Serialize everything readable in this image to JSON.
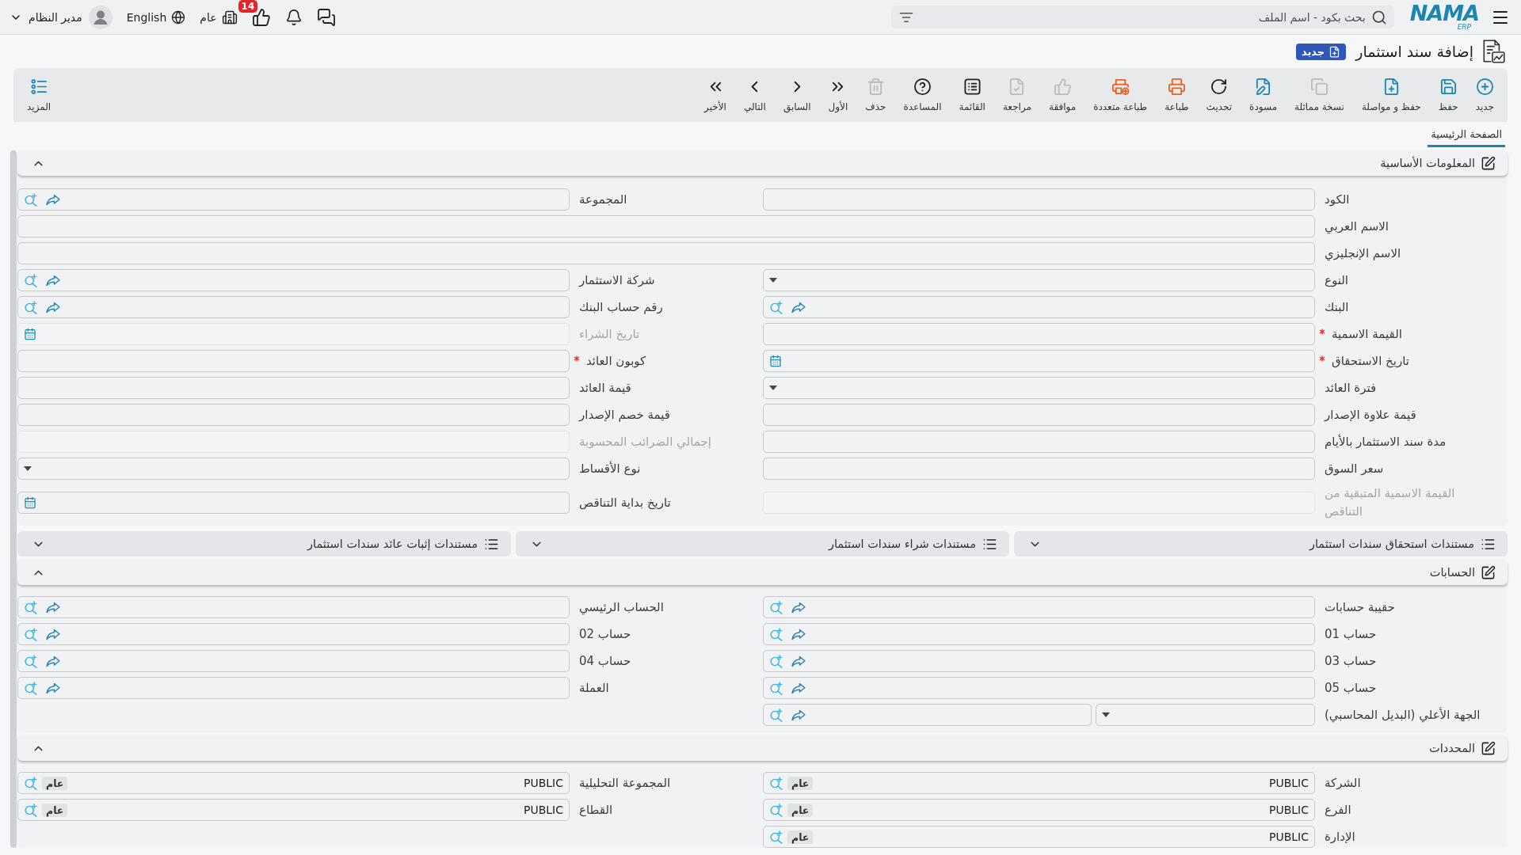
{
  "header": {
    "logo": {
      "name": "NAMA",
      "tagline": "ERP"
    },
    "search": {
      "placeholder": "بحث بكود - اسم الملف"
    },
    "approvals_badge": "14",
    "branch": "عام",
    "language": "English",
    "user": "مدير النظام"
  },
  "page": {
    "title": "إضافة سند استثمار",
    "status": "جديد"
  },
  "toolbar": {
    "buttons": [
      {
        "label": "جديد",
        "kind": "new",
        "disabled": false
      },
      {
        "label": "حفظ",
        "kind": "save",
        "disabled": false
      },
      {
        "label": "حفظ و مواصلة",
        "kind": "save-continue",
        "disabled": false
      },
      {
        "label": "نسخة مماثلة",
        "kind": "duplicate",
        "disabled": true
      },
      {
        "label": "مسودة",
        "kind": "draft",
        "disabled": false
      },
      {
        "label": "تحديث",
        "kind": "refresh",
        "disabled": false
      },
      {
        "label": "طباعة",
        "kind": "print",
        "disabled": false
      },
      {
        "label": "طباعة متعددة",
        "kind": "multi-print",
        "disabled": false
      },
      {
        "label": "موافقة",
        "kind": "approve",
        "disabled": true
      },
      {
        "label": "مراجعة",
        "kind": "review",
        "disabled": true
      },
      {
        "label": "القائمة",
        "kind": "list",
        "disabled": false
      },
      {
        "label": "المساعدة",
        "kind": "help",
        "disabled": false
      },
      {
        "label": "حذف",
        "kind": "delete",
        "disabled": true
      },
      {
        "label": "الأول",
        "kind": "first",
        "disabled": false
      },
      {
        "label": "السابق",
        "kind": "previous",
        "disabled": false
      },
      {
        "label": "التالي",
        "kind": "next",
        "disabled": false
      },
      {
        "label": "الأخير",
        "kind": "last",
        "disabled": false
      }
    ],
    "more": "المزيد"
  },
  "tabs": [
    {
      "label": "الصفحة الرئيسية",
      "selected": true
    }
  ],
  "basic_info": {
    "title": "المعلومات الأساسية",
    "expanded": true,
    "fields": [
      {
        "label": "الكود",
        "kind": "text",
        "required": false,
        "disabled": false
      },
      {
        "label": "المجموعة",
        "kind": "lookup",
        "required": false,
        "disabled": false
      },
      {
        "label": "الاسم العربي",
        "kind": "text",
        "wide": true,
        "required": false,
        "disabled": false
      },
      {
        "label": "الاسم الإنجليزي",
        "kind": "text",
        "wide": true,
        "required": false,
        "disabled": false
      },
      {
        "label": "النوع",
        "kind": "select",
        "required": false,
        "disabled": false
      },
      {
        "label": "شركة الاستثمار",
        "kind": "lookup",
        "required": false,
        "disabled": false
      },
      {
        "label": "البنك",
        "kind": "lookup",
        "required": false,
        "disabled": false
      },
      {
        "label": "رقم حساب البنك",
        "kind": "lookup",
        "required": false,
        "disabled": false
      },
      {
        "label": "القيمة الاسمية",
        "kind": "text",
        "required": true,
        "disabled": false
      },
      {
        "label": "تاريخ الشراء",
        "kind": "date",
        "required": false,
        "disabled": true
      },
      {
        "label": "تاريخ الاستحقاق",
        "kind": "date",
        "required": true,
        "disabled": false
      },
      {
        "label": "كوبون العائد",
        "kind": "text",
        "required": true,
        "disabled": false
      },
      {
        "label": "فترة العائد",
        "kind": "select",
        "required": false,
        "disabled": false
      },
      {
        "label": "قيمة العائد",
        "kind": "text",
        "required": false,
        "disabled": false
      },
      {
        "label": "قيمة علاوة الإصدار",
        "kind": "text",
        "required": false,
        "disabled": false
      },
      {
        "label": "قيمة خصم الإصدار",
        "kind": "text",
        "required": false,
        "disabled": false
      },
      {
        "label": "مدة سند الاستثمار بالأيام",
        "kind": "text",
        "required": false,
        "disabled": false
      },
      {
        "label": "إجمالي الضرائب المحسوبة",
        "kind": "text",
        "required": false,
        "disabled": true
      },
      {
        "label": "سعر السوق",
        "kind": "text",
        "required": false,
        "disabled": false
      },
      {
        "label": "نوع الأقساط",
        "kind": "select",
        "required": false,
        "disabled": false
      },
      {
        "label": "القيمة الاسمية المتبقية من التناقص",
        "kind": "text",
        "required": false,
        "disabled": true
      },
      {
        "label": "تاريخ بداية التناقص",
        "kind": "date",
        "required": false,
        "disabled": false
      }
    ]
  },
  "document_panels": [
    {
      "title": "مستندات استحقاق سندات استثمار",
      "expanded": false
    },
    {
      "title": "مستندات شراء سندات استثمار",
      "expanded": false
    },
    {
      "title": "مستندات إثبات عائد سندات استثمار",
      "expanded": false
    }
  ],
  "accounts": {
    "title": "الحسابات",
    "expanded": true,
    "fields": [
      {
        "label": "حقيبة حسابات",
        "kind": "lookup"
      },
      {
        "label": "الحساب الرئيسي",
        "kind": "lookup"
      },
      {
        "label": "حساب 01",
        "kind": "lookup"
      },
      {
        "label": "حساب 02",
        "kind": "lookup"
      },
      {
        "label": "حساب 03",
        "kind": "lookup"
      },
      {
        "label": "حساب 04",
        "kind": "lookup"
      },
      {
        "label": "حساب 05",
        "kind": "lookup"
      },
      {
        "label": "العملة",
        "kind": "lookup"
      },
      {
        "label": "الجهة الأعلي (البديل المحاسبي)",
        "kind": "select-lookup"
      }
    ]
  },
  "dimensions": {
    "title": "المحددات",
    "expanded": true,
    "fields": [
      {
        "label": "الشركة",
        "kind": "scope",
        "value": "PUBLIC",
        "tag": "عام"
      },
      {
        "label": "المجموعة التحليلية",
        "kind": "scope",
        "value": "PUBLIC",
        "tag": "عام"
      },
      {
        "label": "الفرع",
        "kind": "scope",
        "value": "PUBLIC",
        "tag": "عام"
      },
      {
        "label": "القطاع",
        "kind": "scope",
        "value": "PUBLIC",
        "tag": "عام"
      },
      {
        "label": "الإدارة",
        "kind": "scope",
        "value": "PUBLIC",
        "tag": "عام"
      }
    ]
  }
}
